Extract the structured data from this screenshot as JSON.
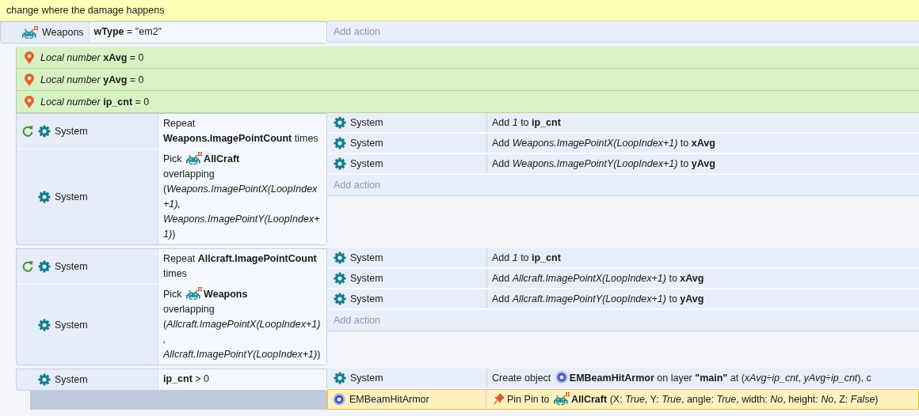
{
  "comment": {
    "text": "change where the damage happens"
  },
  "event": {
    "conditions": [
      {
        "object": "Weapons",
        "kind": "sprite",
        "loop": false,
        "segments": [
          {
            "kind": "text",
            "text": "**wType** = \"em2\""
          }
        ]
      }
    ],
    "add_action": "Add action",
    "children": [
      {
        "kind": "local",
        "text": "*Local number* **xAvg** = 0"
      },
      {
        "kind": "local",
        "text": "*Local number* **yAvg** = 0"
      },
      {
        "kind": "local",
        "text": "*Local number* **ip_cnt** = 0"
      },
      {
        "kind": "event",
        "conditions": [
          {
            "object": "System",
            "kind": "system",
            "loop": true,
            "segments": [
              {
                "kind": "text",
                "text": "Repeat **Weapons.ImagePointCount** times"
              }
            ]
          },
          {
            "object": "System",
            "kind": "system",
            "loop": false,
            "segments": [
              {
                "kind": "text",
                "text": "Pick"
              },
              {
                "kind": "sprite"
              },
              {
                "kind": "text",
                "text": "**AllCraft**"
              },
              {
                "kind": "text",
                "text": "overlapping (*Weapons.ImagePointX(LoopIndex+1), Weapons.ImagePointY(LoopIndex+1)*)"
              }
            ]
          }
        ],
        "actions": [
          {
            "object": "System",
            "kind": "system",
            "selected": false,
            "segments": [
              {
                "kind": "text",
                "text": "Add *1* to **ip_cnt**"
              }
            ]
          },
          {
            "object": "System",
            "kind": "system",
            "selected": false,
            "segments": [
              {
                "kind": "text",
                "text": "Add *Weapons.ImagePointX(LoopIndex+1)* to **xAvg**"
              }
            ]
          },
          {
            "object": "System",
            "kind": "system",
            "selected": false,
            "segments": [
              {
                "kind": "text",
                "text": "Add *Weapons.ImagePointY(LoopIndex+1)* to **yAvg**"
              }
            ]
          }
        ],
        "add_action": "Add action"
      },
      {
        "kind": "event",
        "conditions": [
          {
            "object": "System",
            "kind": "system",
            "loop": true,
            "segments": [
              {
                "kind": "text",
                "text": "Repeat **Allcraft.ImagePointCount** times"
              }
            ]
          },
          {
            "object": "System",
            "kind": "system",
            "loop": false,
            "segments": [
              {
                "kind": "text",
                "text": "Pick"
              },
              {
                "kind": "sprite"
              },
              {
                "kind": "text",
                "text": "**Weapons**"
              },
              {
                "kind": "text",
                "text": "overlapping (*Allcraft.ImagePointX(LoopIndex+1), Allcraft.ImagePointY(LoopIndex+1)*)"
              }
            ]
          }
        ],
        "actions": [
          {
            "object": "System",
            "kind": "system",
            "selected": false,
            "segments": [
              {
                "kind": "text",
                "text": "Add *1* to **ip_cnt**"
              }
            ]
          },
          {
            "object": "System",
            "kind": "system",
            "selected": false,
            "segments": [
              {
                "kind": "text",
                "text": "Add *Allcraft.ImagePointX(LoopIndex+1)* to **xAvg**"
              }
            ]
          },
          {
            "object": "System",
            "kind": "system",
            "selected": false,
            "segments": [
              {
                "kind": "text",
                "text": "Add *Allcraft.ImagePointY(LoopIndex+1)* to **yAvg**"
              }
            ]
          }
        ],
        "add_action": "Add action"
      },
      {
        "kind": "event",
        "conditions": [
          {
            "object": "System",
            "kind": "system",
            "loop": false,
            "segments": [
              {
                "kind": "text",
                "text": "**ip_cnt** > 0"
              }
            ]
          }
        ],
        "actions": [
          {
            "object": "System",
            "kind": "system",
            "selected": false,
            "segments": [
              {
                "kind": "text",
                "text": "Create object"
              },
              {
                "kind": "orb"
              },
              {
                "kind": "text",
                "text": "**EMBeamHitArmor** on layer **\"main\"** at (*xAvg÷ip_cnt*, *yAvg÷ip_cnt*), c"
              }
            ]
          },
          {
            "object": "EMBeamHitArmor",
            "kind": "orb",
            "selected": true,
            "segments": [
              {
                "kind": "pin"
              },
              {
                "kind": "text",
                "text": "Pin Pin to"
              },
              {
                "kind": "sprite"
              },
              {
                "kind": "text",
                "text": "**AllCraft** (X: *True*, Y: *True*, angle: *True*, width: *No*, height: *No*, Z: *False*)"
              }
            ]
          }
        ]
      }
    ]
  }
}
